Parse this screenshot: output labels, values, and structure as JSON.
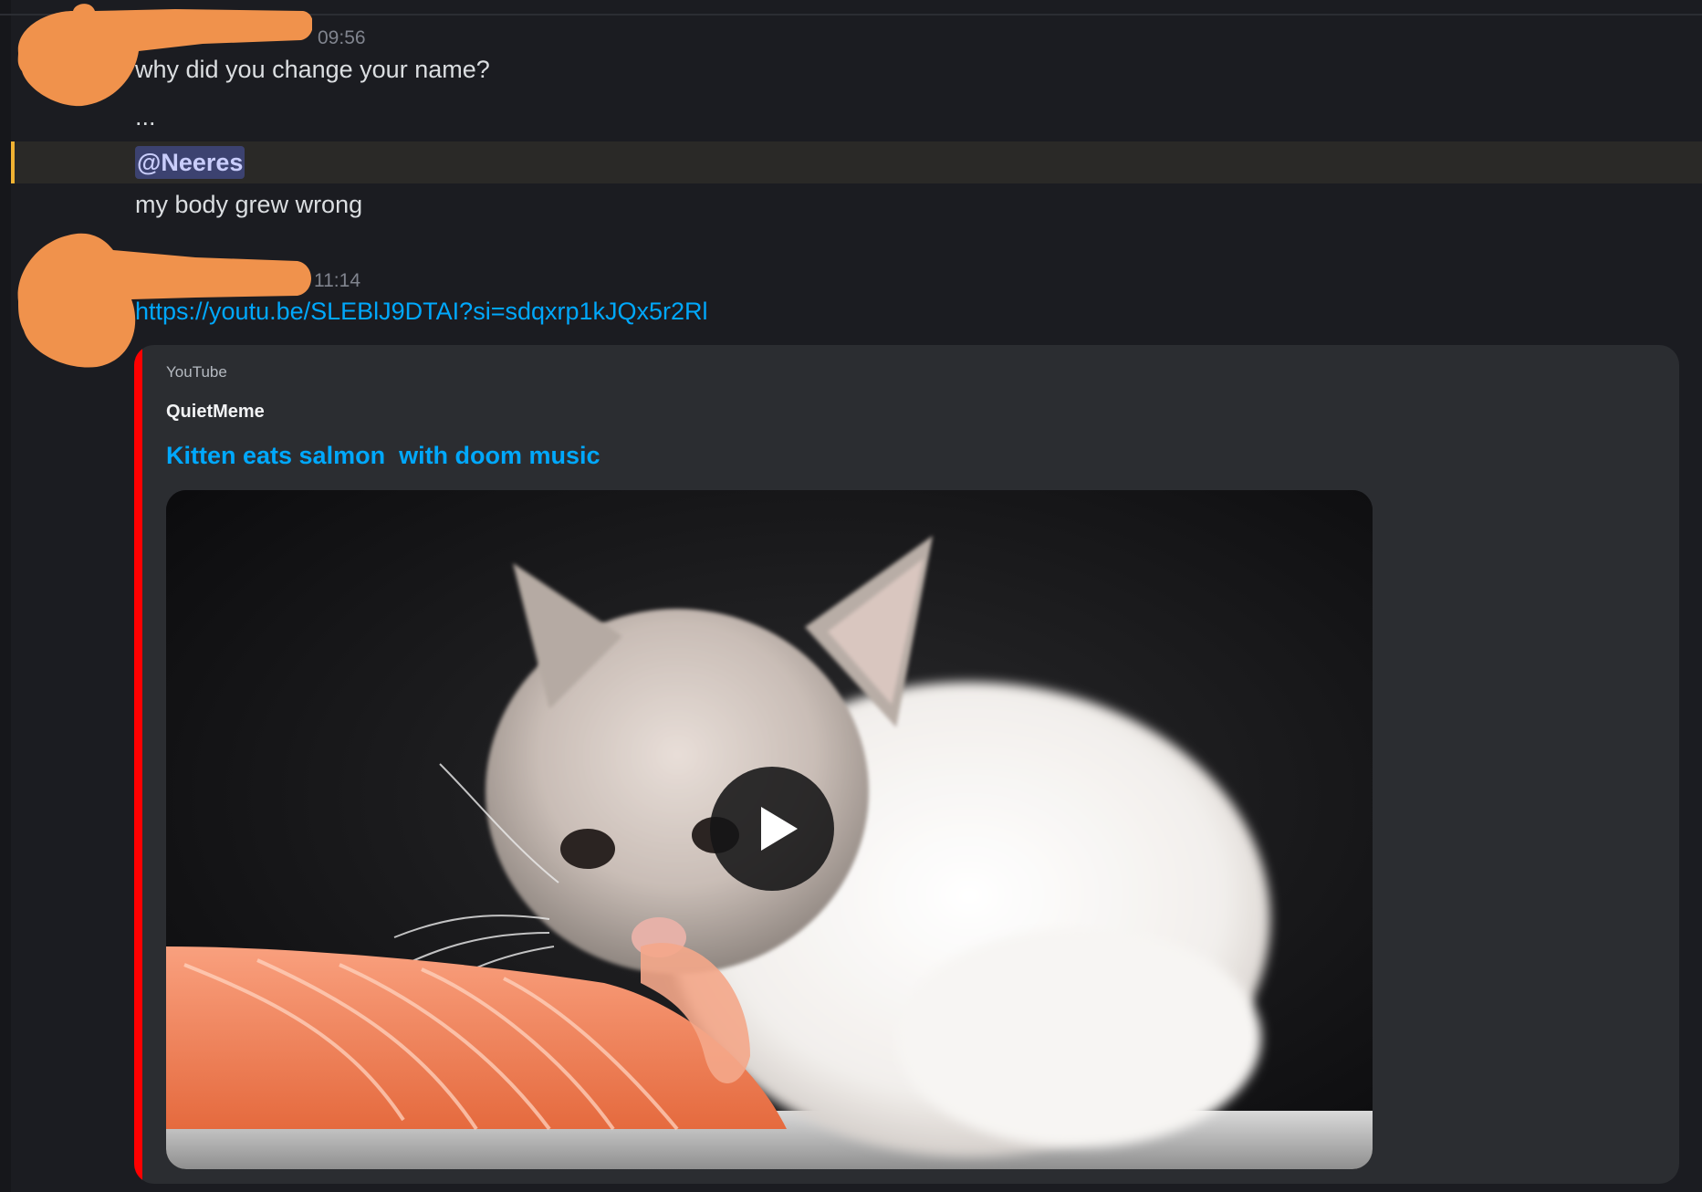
{
  "messages": [
    {
      "timestamp": "09:56",
      "lines": [
        "why did you change your name?",
        "...",
        "my body grew wrong"
      ],
      "mention": "@Neeres"
    },
    {
      "timestamp": "11:14",
      "link": "https://youtu.be/SLEBlJ9DTAI?si=sdqxrp1kJQx5r2Rl",
      "embed": {
        "provider": "YouTube",
        "author": "QuietMeme",
        "title": "Kitten eats salmon  with doom music",
        "thumbnail": "kitten-eating-salmon",
        "play_icon": "play-icon"
      }
    }
  ],
  "colors": {
    "background": "#1b1c21",
    "redaction": "#f0924c",
    "mention_highlight": "#f0b232",
    "link": "#00a8fc",
    "embed_accent": "#ff0000"
  }
}
